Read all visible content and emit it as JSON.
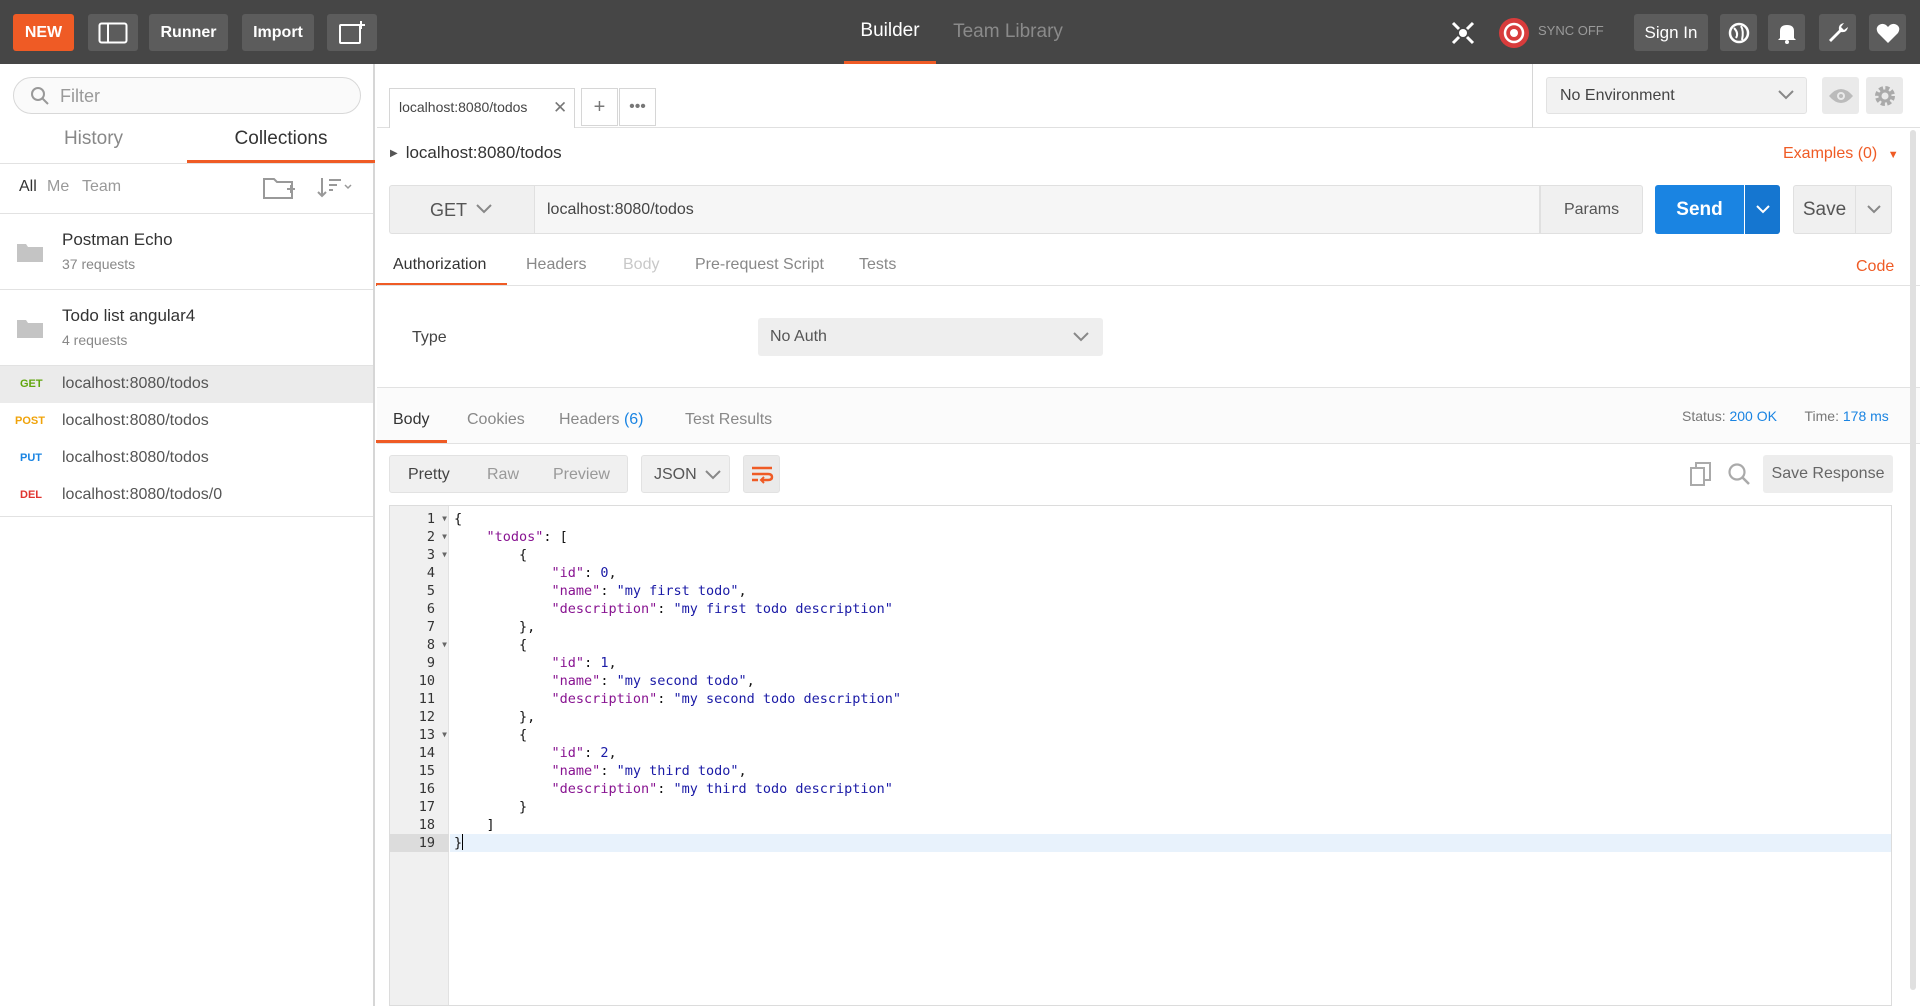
{
  "topbar": {
    "new_label": "NEW",
    "runner_label": "Runner",
    "import_label": "Import",
    "tabs": [
      {
        "label": "Builder"
      },
      {
        "label": "Team Library"
      }
    ],
    "sync_label": "SYNC OFF",
    "signin_label": "Sign In",
    "accent_color": "#ef5b25"
  },
  "sidebar": {
    "filter_placeholder": "Filter",
    "tabs": [
      {
        "label": "History"
      },
      {
        "label": "Collections"
      }
    ],
    "filters": [
      {
        "label": "All"
      },
      {
        "label": "Me"
      },
      {
        "label": "Team"
      }
    ],
    "collections": [
      {
        "name": "Postman Echo",
        "count": "37 requests"
      },
      {
        "name": "Todo list angular4",
        "count": "4 requests"
      }
    ],
    "requests": [
      {
        "method": "GET",
        "url": "localhost:8080/todos",
        "color": "#61a60e"
      },
      {
        "method": "POST",
        "url": "localhost:8080/todos",
        "color": "#f0a30a"
      },
      {
        "method": "PUT",
        "url": "localhost:8080/todos",
        "color": "#1a84e2"
      },
      {
        "method": "DEL",
        "url": "localhost:8080/todos/0",
        "color": "#e0342f"
      }
    ]
  },
  "tabs": {
    "open_tab": "localhost:8080/todos",
    "add": "+",
    "more": "•••"
  },
  "environment": {
    "selected": "No Environment"
  },
  "request": {
    "breadcrumb": "localhost:8080/todos",
    "examples": "Examples (0)",
    "method": "GET",
    "url": "localhost:8080/todos",
    "params_label": "Params",
    "send_label": "Send",
    "save_label": "Save",
    "subtabs": [
      {
        "label": "Authorization"
      },
      {
        "label": "Headers"
      },
      {
        "label": "Body"
      },
      {
        "label": "Pre-request Script"
      },
      {
        "label": "Tests"
      }
    ],
    "code_link": "Code",
    "auth": {
      "type_label": "Type",
      "type_value": "No Auth"
    }
  },
  "response": {
    "tabs": [
      {
        "label": "Body"
      },
      {
        "label": "Cookies"
      },
      {
        "label": "Headers",
        "count": "(6)"
      },
      {
        "label": "Test Results"
      }
    ],
    "status_label": "Status:",
    "status_value": "200 OK",
    "time_label": "Time:",
    "time_value": "178 ms",
    "formats": [
      {
        "label": "Pretty"
      },
      {
        "label": "Raw"
      },
      {
        "label": "Preview"
      }
    ],
    "language": "JSON",
    "save_response_label": "Save Response",
    "lines": [
      "{",
      "    \"todos\": [",
      "        {",
      "            \"id\": 0,",
      "            \"name\": \"my first todo\",",
      "            \"description\": \"my first todo description\"",
      "        },",
      "        {",
      "            \"id\": 1,",
      "            \"name\": \"my second todo\",",
      "            \"description\": \"my second todo description\"",
      "        },",
      "        {",
      "            \"id\": 2,",
      "            \"name\": \"my third todo\",",
      "            \"description\": \"my third todo description\"",
      "        }",
      "    ]",
      "}"
    ],
    "fold_lines": [
      1,
      2,
      3,
      8,
      13
    ],
    "current_line": 19
  }
}
